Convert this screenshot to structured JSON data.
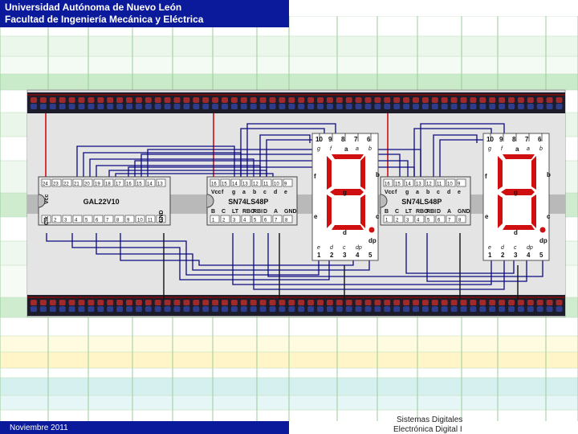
{
  "header": {
    "line1": "Universidad Autónoma de Nuevo León",
    "line2": "Facultad de Ingeniería Mecánica y Eléctrica"
  },
  "footer": {
    "date": "Noviembre 2011",
    "course_line1": "Sistemas Digitales",
    "course_line2": "Electrónica Digital I"
  },
  "circuit": {
    "pld": {
      "name": "GAL22V10",
      "top_pins": [
        "24",
        "23",
        "22",
        "21",
        "20",
        "19",
        "18",
        "17",
        "16",
        "15",
        "14",
        "13"
      ],
      "bottom_pins": [
        "1",
        "2",
        "3",
        "4",
        "5",
        "6",
        "7",
        "8",
        "9",
        "10",
        "11",
        "12"
      ],
      "vcc_label": "Vcc",
      "clk_label": "Clk",
      "gnd_label": "GND"
    },
    "decoder": {
      "name": "SN74LS48P",
      "top_pins": [
        "16",
        "15",
        "14",
        "13",
        "12",
        "11",
        "10",
        "9"
      ],
      "top_labels": [
        "Vcc",
        "f",
        "g",
        "a",
        "b",
        "c",
        "d",
        "e"
      ],
      "bottom_pins": [
        "1",
        "2",
        "3",
        "4",
        "5",
        "6",
        "7",
        "8"
      ],
      "bottom_labels": [
        "B",
        "C",
        "LT",
        "RBO",
        "RBI",
        "D",
        "A",
        "GND"
      ]
    },
    "display": {
      "top_pins": [
        "10",
        "9",
        "8",
        "7",
        "6"
      ],
      "top_labels": [
        "g",
        "f",
        "a",
        "b"
      ],
      "bottom_pins": [
        "1",
        "2",
        "3",
        "4",
        "5"
      ],
      "bottom_labels": [
        "e",
        "d",
        "c",
        "dp"
      ],
      "segments": [
        "a",
        "b",
        "c",
        "d",
        "e",
        "f",
        "g",
        "dp"
      ]
    },
    "colors": {
      "wire": "#0a0a80",
      "power_wire": "#cc1010",
      "segment": "#d01010",
      "chip": "#e6e6e6",
      "rail_red": "#a02a2a",
      "rail_blue": "#2e3c8c"
    }
  }
}
